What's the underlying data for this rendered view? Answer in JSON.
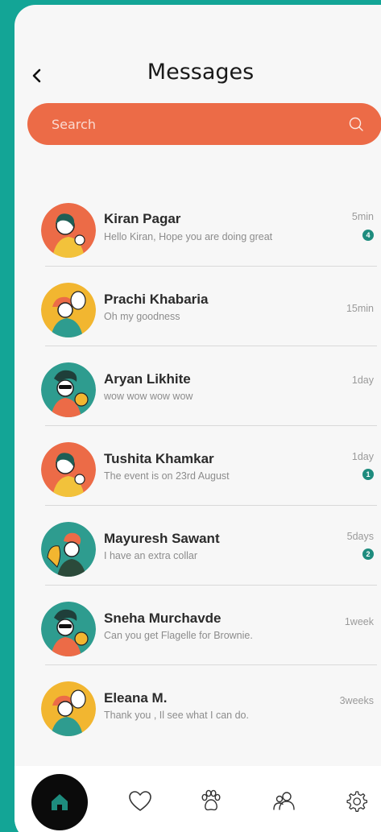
{
  "header": {
    "title": "Messages",
    "back_icon": "chevron-left-icon"
  },
  "search": {
    "placeholder": "Search",
    "icon": "search-icon"
  },
  "conversations": [
    {
      "name": "Kiran Pagar",
      "preview": "Hello Kiran, Hope you are doing great",
      "time": "5min",
      "unread": "4",
      "avatar_bg": "#EC6B47"
    },
    {
      "name": "Prachi Khabaria",
      "preview": "Oh my goodness",
      "time": "15min",
      "unread": "",
      "avatar_bg": "#F2B630"
    },
    {
      "name": "Aryan Likhite",
      "preview": "wow wow wow wow",
      "time": "1day",
      "unread": "",
      "avatar_bg": "#2E9C8F"
    },
    {
      "name": "Tushita Khamkar",
      "preview": "The event is on 23rd August",
      "time": "1day",
      "unread": "1",
      "avatar_bg": "#EC6B47"
    },
    {
      "name": "Mayuresh Sawant",
      "preview": "I have an extra collar",
      "time": "5days",
      "unread": "2",
      "avatar_bg": "#2E9C8F"
    },
    {
      "name": "Sneha Murchavde",
      "preview": "Can you get Flagelle for Brownie.",
      "time": "1week",
      "unread": "",
      "avatar_bg": "#2E9C8F"
    },
    {
      "name": "Eleana M.",
      "preview": "Thank you , Il see what I can do.",
      "time": "3weeks",
      "unread": "",
      "avatar_bg": "#F2B630"
    }
  ],
  "nav": {
    "items": [
      {
        "icon": "home-icon",
        "active": true
      },
      {
        "icon": "heart-icon"
      },
      {
        "icon": "paw-icon"
      },
      {
        "icon": "people-icon"
      },
      {
        "icon": "settings-gear-icon"
      }
    ]
  },
  "colors": {
    "background": "#13A596",
    "accent": "#EC6B47",
    "badge": "#1E8C7E",
    "nav_active": "#0B0B0B",
    "home_icon": "#1E8C7E"
  }
}
